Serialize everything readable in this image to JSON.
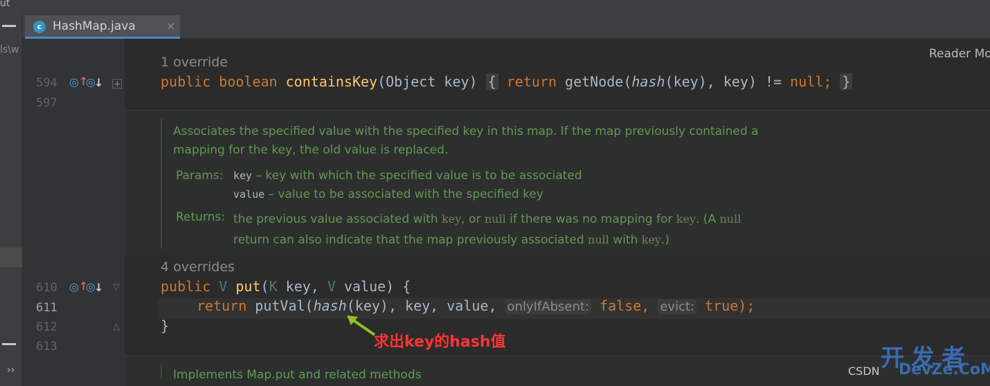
{
  "top_fragment": "ut",
  "left_panel": {
    "path_fragment": "ls\\w",
    "expand": "››"
  },
  "tab": {
    "icon_letter": "c",
    "label": "HashMap.java",
    "close": "×"
  },
  "reader_mode": "Reader Mo",
  "lines": {
    "l594": "594",
    "l597": "597",
    "l610": "610",
    "l611": "611",
    "l612": "612",
    "l613": "613"
  },
  "code": {
    "override1": "1 override",
    "overrides4": "4 overrides",
    "contains_key": {
      "public": "public",
      "boolean": "boolean",
      "name": "containsKey",
      "params": "(Object key)",
      "open": "{",
      "ret": "return",
      "call": "getNode(",
      "hash": "hash",
      "args": "(key), key) != ",
      "null": "null",
      "semi": ";",
      "close": "}"
    },
    "put": {
      "public": "public",
      "v": "V",
      "name": "put",
      "open_paren": "(",
      "k": "K",
      "key": " key, ",
      "v2": "V",
      "value": " value) {"
    },
    "put_body": {
      "ret": "return",
      "call": " putVal(",
      "hash": "hash",
      "args": "(key), key, value, ",
      "hint1": "onlyIfAbsent:",
      "false": "false",
      "comma": ", ",
      "hint2": "evict:",
      "true": "true",
      "end": ");"
    },
    "close_brace": "}"
  },
  "doc_put": {
    "line1": "Associates the specified value with the specified key in this map. If the map previously contained a",
    "line2": "mapping for the key, the old value is replaced.",
    "params_tag": "Params:",
    "param1_name": "key",
    "param1_desc": " – key with which the specified value is to be associated",
    "param2_name": "value",
    "param2_desc": " – value to be associated with the specified key",
    "returns_tag": "Returns:",
    "ret1_a": "the previous value associated with ",
    "ret1_key": "key",
    "ret1_b": ", or ",
    "ret1_null": "null",
    "ret1_c": " if there was no mapping for ",
    "ret1_key2": "key",
    "ret1_d": ". (A ",
    "ret1_null2": "null",
    "ret2_a": "return can also indicate that the map previously associated ",
    "ret2_null": "null",
    "ret2_b": " with ",
    "ret2_key": "key",
    "ret2_c": ".)"
  },
  "doc_next": "Implements Map.put and related methods",
  "annotation": "求出key的hash值",
  "watermark": {
    "big": "开发者",
    "csdn": "CSDN",
    "devze": "DevZe.CoM"
  },
  "colors": {
    "annotation": "#ff3333",
    "arrow": "#8fc31f",
    "doc_text": "#629755"
  }
}
